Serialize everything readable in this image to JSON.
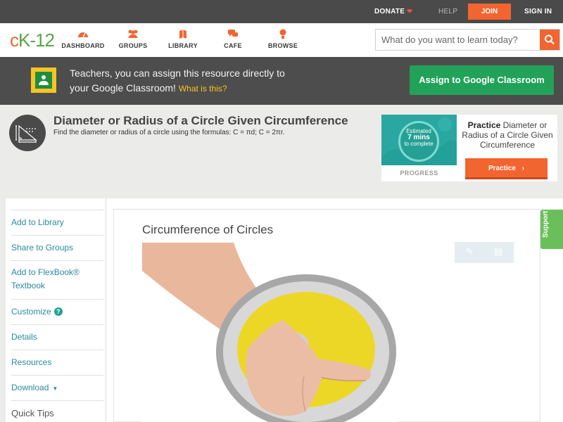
{
  "topbar": {
    "donate": "DONATE",
    "help": "HELP",
    "join": "JOIN",
    "signin": "SIGN IN"
  },
  "nav": {
    "logo": {
      "c": "c",
      "k": "K",
      "dash": "-",
      "num": "12"
    },
    "items": [
      {
        "label": "DASHBOARD",
        "icon": "dashboard-icon"
      },
      {
        "label": "GROUPS",
        "icon": "groups-icon"
      },
      {
        "label": "LIBRARY",
        "icon": "library-icon"
      },
      {
        "label": "CAFE",
        "icon": "cafe-icon"
      },
      {
        "label": "BROWSE",
        "icon": "browse-icon"
      }
    ],
    "search_placeholder": "What do you want to learn today?"
  },
  "banner": {
    "line1": "Teachers, you can assign this resource directly to",
    "line2": "your Google Classroom!",
    "what": "What is this?",
    "assign_button": "Assign to Google Classroom"
  },
  "concept": {
    "title": "Diameter or Radius of a Circle Given Circumference",
    "description": "Find the diameter or radius of a circle using the formulas: C = πd; C = 2πr."
  },
  "practice": {
    "estimated": "Estimated",
    "mins": "7 mins",
    "complete": "to complete",
    "progress_label": "PROGRESS",
    "practice_word": "Practice",
    "practice_rest": "Diameter or Radius of a Circle Given Circumference",
    "button": "Practice"
  },
  "sidebar": {
    "items": [
      {
        "label": "Add to Library"
      },
      {
        "label": "Share to Groups"
      },
      {
        "label": "Add to FlexBook® Textbook"
      },
      {
        "label": "Customize"
      },
      {
        "label": "Details"
      },
      {
        "label": "Resources"
      },
      {
        "label": "Download"
      },
      {
        "label": "Quick Tips"
      }
    ],
    "help_badge": "?"
  },
  "content": {
    "title": "Circumference of Circles"
  },
  "support": "Support",
  "colors": {
    "brand_orange": "#f26531",
    "brand_green": "#58a545",
    "assign_green": "#22a259",
    "link_teal": "#2a8a9e"
  }
}
